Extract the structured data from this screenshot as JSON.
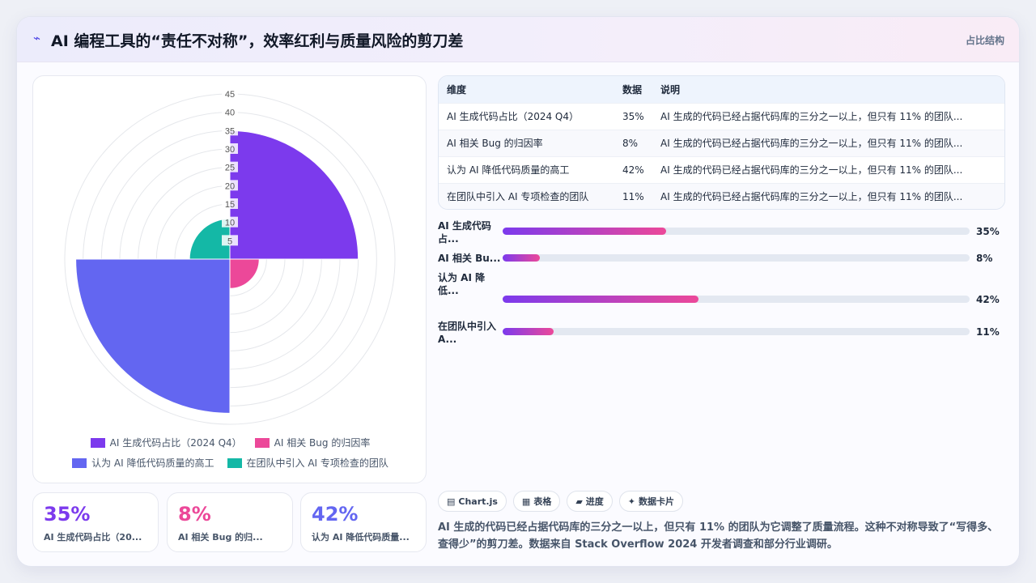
{
  "header": {
    "icon": "bolt-icon",
    "title": "AI 编程工具的“责任不对称”，效率红利与质量风险的剪刀差",
    "tag": "占比结构"
  },
  "chart_data": {
    "type": "polarArea",
    "title": "",
    "categories": [
      "AI 生成代码占比（2024 Q4）",
      "AI 相关 Bug 的归因率",
      "认为 AI 降低代码质量的高工",
      "在团队中引入 AI 专项检查的团队"
    ],
    "values": [
      35,
      8,
      42,
      11
    ],
    "colors": [
      "#7c3aed",
      "#ec4899",
      "#6366f1",
      "#14b8a6"
    ],
    "r_ticks": [
      5,
      10,
      15,
      20,
      25,
      30,
      35,
      40,
      45
    ],
    "rlim": [
      0,
      45
    ],
    "grid": true,
    "legend_position": "bottom"
  },
  "legend": {
    "row1": [
      "AI 生成代码占比（2024 Q4）",
      "AI 相关 Bug 的归因率"
    ],
    "row2": [
      "认为 AI 降低代码质量的高工",
      "在团队中引入 AI 专项检查的团队"
    ]
  },
  "kpis": [
    {
      "value": "35%",
      "label": "AI 生成代码占比（20...",
      "color": "#7c3aed"
    },
    {
      "value": "8%",
      "label": "AI 相关 Bug 的归...",
      "color": "#ec4899"
    },
    {
      "value": "42%",
      "label": "认为 AI 降低代码质量...",
      "color": "#6366f1"
    }
  ],
  "table": {
    "headers": [
      "维度",
      "数据",
      "说明"
    ],
    "rows": [
      [
        "AI 生成代码占比（2024 Q4）",
        "35%",
        "AI 生成的代码已经占据代码库的三分之一以上，但只有 11% 的团队..."
      ],
      [
        "AI 相关 Bug 的归因率",
        "8%",
        "AI 生成的代码已经占据代码库的三分之一以上，但只有 11% 的团队..."
      ],
      [
        "认为 AI 降低代码质量的高工",
        "42%",
        "AI 生成的代码已经占据代码库的三分之一以上，但只有 11% 的团队..."
      ],
      [
        "在团队中引入 AI 专项检查的团队",
        "11%",
        "AI 生成的代码已经占据代码库的三分之一以上，但只有 11% 的团队..."
      ]
    ]
  },
  "progress": [
    {
      "name_l1": "AI 生成代码",
      "name_l2": "占...",
      "value": 35,
      "label": "35%"
    },
    {
      "name_l1": "AI 相关 Bu...",
      "name_l2": "",
      "value": 8,
      "label": "8%"
    },
    {
      "name_l1": "认为 AI 降",
      "name_l2": "低...",
      "value": 42,
      "label": "42%"
    },
    {
      "name_l1": "在团队中引入",
      "name_l2": "A...",
      "value": 11,
      "label": "11%"
    }
  ],
  "chips": [
    {
      "icon": "chart-icon",
      "glyph": "▤",
      "label": "Chart.js"
    },
    {
      "icon": "table-icon",
      "glyph": "▦",
      "label": "表格"
    },
    {
      "icon": "progress-icon",
      "glyph": "▰",
      "label": "进度"
    },
    {
      "icon": "sparkle-icon",
      "glyph": "✦",
      "label": "数据卡片"
    }
  ],
  "note": "AI 生成的代码已经占据代码库的三分之一以上，但只有 11% 的团队为它调整了质量流程。这种不对称导致了“写得多、查得少”的剪刀差。数据来自 Stack Overflow 2024 开发者调查和部分行业调研。"
}
